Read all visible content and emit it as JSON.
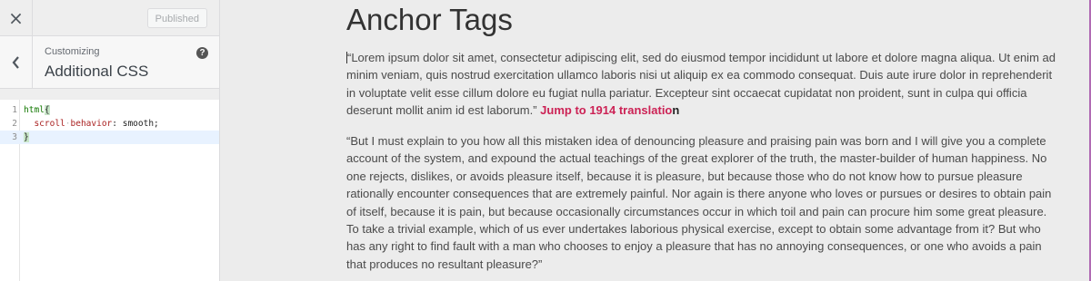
{
  "sidebar": {
    "close_glyph": "×",
    "publish_label": "Published",
    "customizing_label": "Customizing",
    "section_title": "Additional CSS",
    "help_glyph": "?"
  },
  "editor": {
    "lines": [
      {
        "num": "1",
        "tag": "html",
        "brace": "{"
      },
      {
        "num": "2",
        "prop": "scroll",
        "dot": "·",
        "prop2": "behavior",
        "rest": ": smooth;"
      },
      {
        "num": "3",
        "brace": "}"
      }
    ]
  },
  "preview": {
    "title": "Anchor Tags",
    "para1_text": "“Lorem ipsum dolor sit amet, consectetur adipiscing elit, sed do eiusmod tempor incididunt ut labore et dolore magna aliqua. Ut enim ad minim veniam, quis nostrud exercitation ullamco laboris nisi ut aliquip ex ea commodo consequat. Duis aute irure dolor in reprehenderit in voluptate velit esse cillum dolore eu fugiat nulla pariatur. Excepteur sint occaecat cupidatat non proident, sunt in culpa qui officia deserunt mollit anim id est laborum.”",
    "link_text": "Jump to 1914 translatio",
    "link_tail": "n",
    "para2_text": "“But I must explain to you how all this mistaken idea of denouncing pleasure and praising pain was born and I will give you a complete account of the system, and expound the actual teachings of the great explorer of the truth, the master-builder of human happiness. No one rejects, dislikes, or avoids pleasure itself, because it is pleasure, but because those who do not know how to pursue pleasure rationally encounter consequences that are extremely painful. Nor again is there anyone who loves or pursues or desires to obtain pain of itself, because it is pain, but because occasionally circumstances occur in which toil and pain can procure him some great pleasure. To take a trivial example, which of us ever undertakes laborious physical exercise, except to obtain some advantage from it? But who has any right to find fault with a man who chooses to enjoy a pleasure that has no annoying consequences, or one who avoids a pain that produces no resultant pleasure?”"
  },
  "colors": {
    "link": "#cc2255",
    "background": "#ececec"
  }
}
